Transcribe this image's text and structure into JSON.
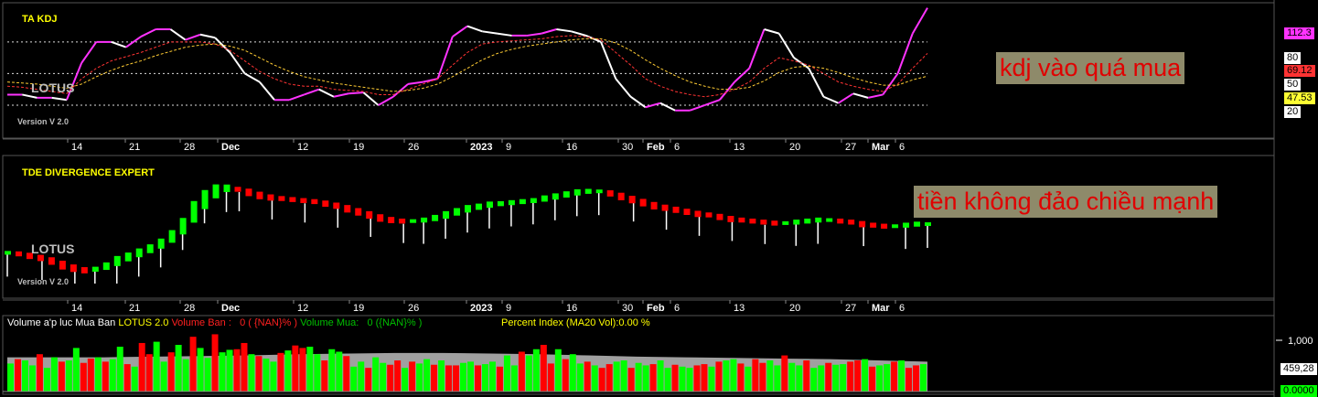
{
  "kdj_panel": {
    "title": "TA KDJ",
    "watermark": "LOTUS",
    "version": "Version V 2.0",
    "annotation": "kdj vào quá mua",
    "axis_levels": [
      "80",
      "50",
      "20"
    ],
    "last_values": {
      "j": "112.3",
      "k": "69.12",
      "d": "47.53"
    }
  },
  "tde_panel": {
    "title": "TDE DIVERGENCE EXPERT",
    "watermark": "LOTUS",
    "version": "Version V 2.0",
    "annotation": "tiền không đảo chiều mạnh"
  },
  "volume_panel": {
    "title_prefix": "Volume a'p luc Mua Ban",
    "lotus_label": "LOTUS 2.0",
    "ban_label": "Volume Ban :",
    "ban_value": "0 ( {NAN}% )",
    "mua_label": "Volume Mua:",
    "mua_value": "0 ({NAN}% )",
    "percent_index": "Percent Index (MA20 Vol):0.00 %",
    "axis_labels": [
      "1,000",
      "459,28",
      "0.0000"
    ]
  },
  "date_axis": [
    "14",
    "21",
    "28",
    "Dec",
    "12",
    "19",
    "26",
    "2023",
    "9",
    "16",
    "30",
    "Feb",
    "6",
    "13",
    "20",
    "27",
    "Mar",
    "6"
  ],
  "colors": {
    "j": "#ff33ff",
    "k": "#ff3333",
    "d": "#ffcc33",
    "up": "#00ff00",
    "down": "#ff0000",
    "vol_ma": "#a0a0a0"
  },
  "chart_data": [
    {
      "type": "line",
      "title": "TA KDJ",
      "ylim": [
        0,
        100
      ],
      "reference_levels": [
        80,
        50,
        20
      ],
      "series": [
        {
          "name": "J",
          "values": [
            30,
            30,
            27,
            27,
            25,
            60,
            80,
            80,
            75,
            85,
            92,
            92,
            82,
            87,
            84,
            70,
            50,
            42,
            25,
            25,
            30,
            35,
            28,
            31,
            32,
            20,
            28,
            40,
            42,
            45,
            85,
            95,
            90,
            88,
            86,
            86,
            88,
            92,
            90,
            86,
            80,
            45,
            28,
            18,
            22,
            15,
            15,
            20,
            25,
            42,
            55,
            92,
            88,
            65,
            55,
            28,
            22,
            31,
            27,
            30,
            50,
            88,
            112.3
          ]
        },
        {
          "name": "K",
          "values": [
            38,
            37,
            35,
            33,
            31,
            45,
            55,
            62,
            66,
            70,
            75,
            80,
            80,
            80,
            78,
            72,
            62,
            52,
            45,
            40,
            38,
            38,
            35,
            34,
            33,
            30,
            30,
            35,
            40,
            45,
            58,
            70,
            78,
            80,
            81,
            82,
            83,
            85,
            86,
            85,
            82,
            70,
            58,
            45,
            38,
            33,
            30,
            28,
            30,
            35,
            42,
            55,
            65,
            62,
            58,
            50,
            42,
            38,
            35,
            33,
            40,
            55,
            69.12
          ]
        },
        {
          "name": "D",
          "values": [
            42,
            41,
            40,
            38,
            36,
            40,
            47,
            53,
            58,
            62,
            67,
            71,
            75,
            77,
            78,
            76,
            72,
            65,
            58,
            52,
            47,
            44,
            41,
            39,
            37,
            35,
            33,
            34,
            36,
            40,
            47,
            55,
            63,
            69,
            73,
            76,
            78,
            80,
            82,
            83,
            83,
            79,
            72,
            63,
            55,
            48,
            42,
            38,
            35,
            35,
            37,
            43,
            51,
            56,
            57,
            55,
            51,
            46,
            42,
            39,
            39,
            44,
            47.53
          ]
        }
      ]
    },
    {
      "type": "bar",
      "title": "TDE DIVERGENCE EXPERT",
      "series": [
        {
          "name": "TDE",
          "values": [
            30,
            29,
            27,
            25,
            22,
            18,
            15,
            13,
            14,
            17,
            22,
            26,
            30,
            34,
            39,
            46,
            56,
            70,
            82,
            90,
            93,
            92,
            89,
            86,
            84,
            83,
            82,
            81,
            80,
            78,
            76,
            73,
            70,
            67,
            64,
            62,
            61,
            61,
            62,
            64,
            67,
            70,
            73,
            75,
            77,
            78,
            79,
            80,
            81,
            83,
            85,
            87,
            89,
            90,
            90,
            88,
            85,
            82,
            79,
            76,
            74,
            72,
            70,
            68,
            67,
            65,
            63,
            62,
            61,
            60,
            59,
            59,
            60,
            61,
            62,
            62,
            61,
            60,
            58,
            57,
            56,
            56,
            57,
            58,
            58
          ]
        }
      ]
    },
    {
      "type": "bar",
      "title": "Volume a'p luc Mua Ban",
      "series": [
        {
          "name": "Volume",
          "values": [
            0.45,
            0.52,
            0.5,
            0.42,
            0.6,
            0.38,
            0.55,
            0.48,
            0.5,
            0.7,
            0.46,
            0.53,
            0.55,
            0.48,
            0.52,
            0.72,
            0.44,
            0.4,
            0.78,
            0.6,
            0.8,
            0.48,
            0.63,
            0.75,
            0.52,
            0.88,
            0.7,
            0.54,
            0.92,
            0.63,
            0.67,
            0.68,
            0.78,
            0.6,
            0.57,
            0.53,
            0.48,
            0.62,
            0.66,
            0.74,
            0.7,
            0.72,
            0.6,
            0.5,
            0.68,
            0.64,
            0.57,
            0.4,
            0.48,
            0.38,
            0.55,
            0.46,
            0.43,
            0.5,
            0.38,
            0.48,
            0.45,
            0.52,
            0.43,
            0.5,
            0.42,
            0.42,
            0.46,
            0.48,
            0.42,
            0.44,
            0.48,
            0.4,
            0.58,
            0.42,
            0.64,
            0.58,
            0.68,
            0.75,
            0.45,
            0.68,
            0.52,
            0.6,
            0.45,
            0.48,
            0.42,
            0.38,
            0.44,
            0.48,
            0.5,
            0.38,
            0.46,
            0.42,
            0.44,
            0.5,
            0.38,
            0.43,
            0.4,
            0.38,
            0.42,
            0.44,
            0.4,
            0.48,
            0.5,
            0.52,
            0.45,
            0.4,
            0.52,
            0.46,
            0.5,
            0.42,
            0.58,
            0.46,
            0.42,
            0.5,
            0.38,
            0.42,
            0.46,
            0.43,
            0.44,
            0.48,
            0.5,
            0.52,
            0.4,
            0.42,
            0.44,
            0.48,
            0.5,
            0.38,
            0.42,
            0.44
          ]
        },
        {
          "name": "MA20 Vol",
          "values": [
            0.55,
            0.55,
            0.55,
            0.56,
            0.57,
            0.58,
            0.6,
            0.61,
            0.62,
            0.62,
            0.61,
            0.6,
            0.58,
            0.56,
            0.55,
            0.54,
            0.53,
            0.52,
            0.5,
            0.48
          ]
        }
      ]
    }
  ]
}
